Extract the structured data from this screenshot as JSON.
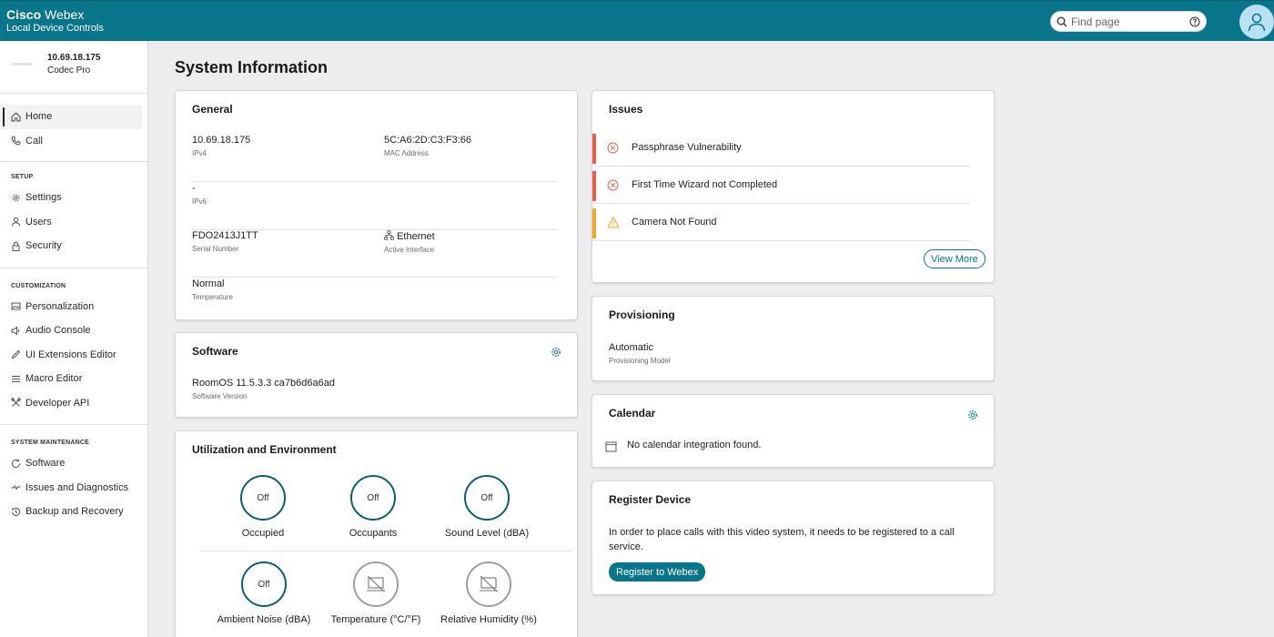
{
  "header": {
    "brand_bold": "Cisco",
    "brand_light": "Webex",
    "subtitle": "Local Device Controls",
    "search_placeholder": "Find page"
  },
  "device": {
    "ip": "10.69.18.175",
    "model": "Codec Pro"
  },
  "sidebar": {
    "main": [
      {
        "label": "Home",
        "icon": "home-icon",
        "active": true
      },
      {
        "label": "Call",
        "icon": "phone-icon"
      }
    ],
    "setup": {
      "heading": "SETUP",
      "items": [
        {
          "label": "Settings",
          "icon": "gear-icon"
        },
        {
          "label": "Users",
          "icon": "user-icon"
        },
        {
          "label": "Security",
          "icon": "lock-icon"
        }
      ]
    },
    "customization": {
      "heading": "CUSTOMIZATION",
      "items": [
        {
          "label": "Personalization",
          "icon": "image-icon"
        },
        {
          "label": "Audio Console",
          "icon": "speaker-icon"
        },
        {
          "label": "UI Extensions Editor",
          "icon": "pencil-icon"
        },
        {
          "label": "Macro Editor",
          "icon": "list-icon"
        },
        {
          "label": "Developer API",
          "icon": "tools-icon"
        }
      ]
    },
    "maintenance": {
      "heading": "SYSTEM MAINTENANCE",
      "items": [
        {
          "label": "Software",
          "icon": "refresh-icon"
        },
        {
          "label": "Issues and Diagnostics",
          "icon": "pulse-icon"
        },
        {
          "label": "Backup and Recovery",
          "icon": "history-icon"
        }
      ]
    }
  },
  "page_title": "System Information",
  "general": {
    "title": "General",
    "ipv4_value": "10.69.18.175",
    "ipv4_label": "IPv4",
    "mac_value": "5C:A6:2D:C3:F3:66",
    "mac_label": "MAC Address",
    "ipv6_value": "-",
    "ipv6_label": "IPv6",
    "serial_value": "FDO2413J1TT",
    "serial_label": "Serial Number",
    "interface_value": "Ethernet",
    "interface_label": "Active Interface",
    "temp_value": "Normal",
    "temp_label": "Temperature"
  },
  "software": {
    "title": "Software",
    "version_value": "RoomOS 11.5.3.3 ca7b6d6a6ad",
    "version_label": "Software Version"
  },
  "utilization": {
    "title": "Utilization and Environment",
    "gauges": [
      {
        "value": "Off",
        "label": "Occupied"
      },
      {
        "value": "Off",
        "label": "Occupants"
      },
      {
        "value": "Off",
        "label": "Sound Level (dBA)"
      },
      {
        "value": "Off",
        "label": "Ambient Noise (dBA)"
      },
      {
        "value": "",
        "label": "Temperature (°C/°F)",
        "icon": "no-sensor-icon"
      },
      {
        "value": "",
        "label": "Relative Humidity (%)",
        "icon": "no-sensor-icon"
      }
    ]
  },
  "issues": {
    "title": "Issues",
    "items": [
      {
        "text": "Passphrase Vulnerability",
        "severity": "error"
      },
      {
        "text": "First Time Wizard not Completed",
        "severity": "error"
      },
      {
        "text": "Camera Not Found",
        "severity": "warning"
      }
    ],
    "view_more": "View More"
  },
  "provisioning": {
    "title": "Provisioning",
    "model_value": "Automatic",
    "model_label": "Provisioning Model"
  },
  "calendar": {
    "title": "Calendar",
    "message": "No calendar integration found."
  },
  "register": {
    "title": "Register Device",
    "text": "In order to place calls with this video system, it needs to be registered to a call service.",
    "button": "Register to Webex"
  },
  "colors": {
    "brand": "#08758a",
    "error": "#e8604c",
    "warning": "#f5a623"
  }
}
